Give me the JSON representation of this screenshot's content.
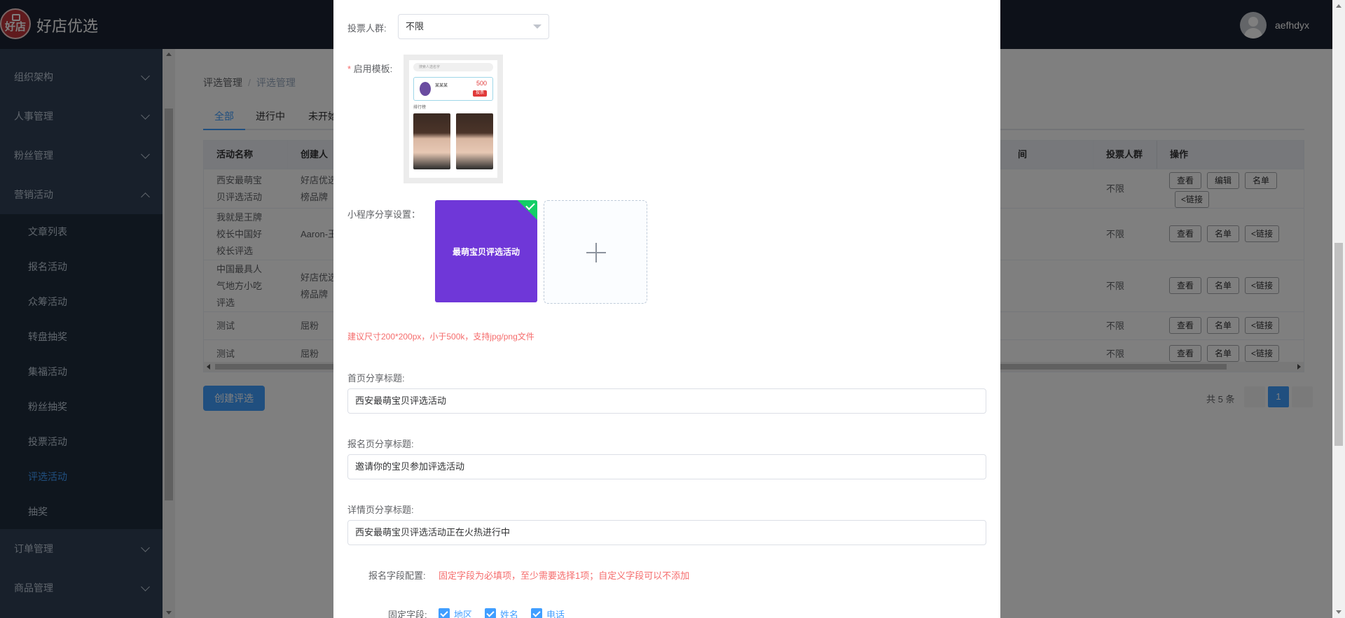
{
  "header": {
    "logo_text": "好店",
    "brand": "好店优选",
    "username": "aefhdyx"
  },
  "sidebar": {
    "items": [
      {
        "label": "组织架构"
      },
      {
        "label": "人事管理"
      },
      {
        "label": "粉丝管理"
      },
      {
        "label": "营销活动"
      },
      {
        "label": "订单管理"
      },
      {
        "label": "商品管理"
      }
    ],
    "submenu": [
      {
        "label": "文章列表"
      },
      {
        "label": "报名活动"
      },
      {
        "label": "众筹活动"
      },
      {
        "label": "转盘抽奖"
      },
      {
        "label": "集福活动"
      },
      {
        "label": "粉丝抽奖"
      },
      {
        "label": "投票活动"
      },
      {
        "label": "评选活动"
      },
      {
        "label": "抽奖"
      }
    ]
  },
  "breadcrumb": {
    "root": "评选管理",
    "sep": "/",
    "current": "评选管理"
  },
  "tabs": [
    {
      "label": "全部"
    },
    {
      "label": "进行中"
    },
    {
      "label": "未开始"
    }
  ],
  "table": {
    "headers": {
      "name": "活动名称",
      "creator": "创建人",
      "partial": "间",
      "crowd": "投票人群",
      "ops": "操作"
    },
    "rows": [
      {
        "name": "西安最萌宝\n贝评选活动",
        "creator": "好店优选\n榜品牌",
        "crowd": "不限"
      },
      {
        "name": "我就是王牌\n校长中国好\n校长评选",
        "creator": "Aaron-王",
        "crowd": "不限"
      },
      {
        "name": "中国最具人\n气地方小吃\n评选",
        "creator": "好店优选\n榜品牌",
        "crowd": "不限"
      },
      {
        "name": "测试",
        "creator": "屈粉",
        "crowd": "不限"
      },
      {
        "name": "测试",
        "creator": "屈粉",
        "crowd": "不限"
      }
    ],
    "btn_view": "查看",
    "btn_edit": "编辑",
    "btn_list": "名单",
    "btn_link": "链接"
  },
  "create_button": "创建评选",
  "pager": {
    "total": "共 5 条",
    "current": "1"
  },
  "dialog": {
    "crowd_label": "投票人群:",
    "crowd_value": "不限",
    "template_label": "启用模板:",
    "template_preview": {
      "search_hint": "搜索人选名字",
      "name": "某某某",
      "votes_label": "500",
      "vote_button": "投票",
      "section": "排行榜"
    },
    "share_label": "小程序分享设置：",
    "share_image_text": "最萌宝贝评选活动",
    "size_hint": "建议尺寸200*200px，小于500k，支持jpg/png文件",
    "home_title_label": "首页分享标题:",
    "home_title_value": "西安最萌宝贝评选活动",
    "signup_title_label": "报名页分享标题:",
    "signup_title_value": "邀请你的宝贝参加评选活动",
    "detail_title_label": "详情页分享标题:",
    "detail_title_value": "西安最萌宝贝评选活动正在火热进行中",
    "field_config_label": "报名字段配置:",
    "field_config_hint": "固定字段为必填项，至少需要选择1项；自定义字段可以不添加",
    "fixed_fields_label": "固定字段:",
    "fixed_fields": [
      {
        "label": "地区"
      },
      {
        "label": "姓名"
      },
      {
        "label": "电话"
      }
    ]
  }
}
